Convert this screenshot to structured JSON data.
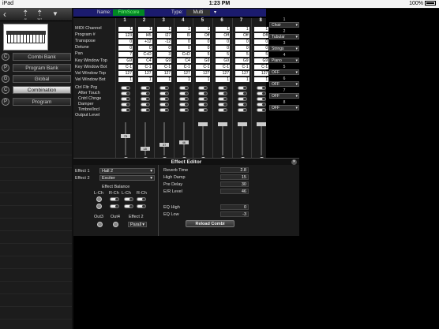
{
  "status": {
    "device": "iPad",
    "wifi": "wifi-icon",
    "time": "1:23 PM",
    "battery": "100%"
  },
  "toolbar": {
    "b1": "All",
    "b2": "SET"
  },
  "thumbnail": {
    "caption": ""
  },
  "nav": [
    {
      "label": "Combi Bank",
      "icon": "C"
    },
    {
      "label": "Program Bank",
      "icon": "P"
    },
    {
      "label": "Global",
      "icon": "G"
    },
    {
      "label": "Combination",
      "icon": "C",
      "active": true
    },
    {
      "label": "Program",
      "icon": "P"
    }
  ],
  "header": {
    "name_label": "Name:",
    "name_value": "FilmScore",
    "type_label": "Type:",
    "type_value": "Multi"
  },
  "tracks": [
    "1",
    "2",
    "3",
    "4",
    "5",
    "6",
    "7",
    "8"
  ],
  "rows": [
    {
      "label": "MIDI Channel",
      "values": [
        "1",
        "1",
        "1",
        "1",
        "1",
        "1",
        "1",
        "1"
      ]
    },
    {
      "label": "Program #",
      "values": [
        "123",
        "I45",
        "I27",
        "I9",
        "Off",
        "Off",
        "Off",
        "Off"
      ]
    },
    {
      "label": "Transpose",
      "values": [
        "0",
        "+12",
        "-12",
        "0",
        "0",
        "0",
        "0",
        "0"
      ]
    },
    {
      "label": "Detune",
      "values": [
        "0",
        "0",
        "0",
        "0",
        "0",
        "0",
        "0",
        "0"
      ]
    },
    {
      "label": "Pan",
      "values": [
        "7",
        "C+D",
        "3",
        "C+D",
        "5",
        "5",
        "5",
        "5"
      ]
    },
    {
      "label": "Key Window Top",
      "values": [
        "G9",
        "C4",
        "G9",
        "C4",
        "G9",
        "G9",
        "G9",
        "G9"
      ]
    },
    {
      "label": "Key Window Bot",
      "values": [
        "C-1",
        "C-1",
        "C-1",
        "C-1",
        "C-1",
        "C-1",
        "C-1",
        "C-1"
      ]
    },
    {
      "label": "Vel Window Top",
      "values": [
        "127",
        "127",
        "127",
        "127",
        "127",
        "127",
        "127",
        "127"
      ]
    },
    {
      "label": "Vel Window Bot",
      "values": [
        "1",
        "1",
        "1",
        "1",
        "1",
        "1",
        "1",
        "1"
      ]
    }
  ],
  "switch_rows": [
    "Ctrl Fltr Prg",
    "After Touch",
    "Cntrl Chnge",
    "Damper",
    "Timbre/Incl"
  ],
  "output_level_label": "Output Level",
  "fader_values": [
    "75",
    "18",
    "37",
    "46",
    "",
    "",
    "",
    ""
  ],
  "right_panel": [
    {
      "num": "1",
      "value": "Choir"
    },
    {
      "num": "2",
      "value": "Tubular"
    },
    {
      "num": "3",
      "value": "Strings"
    },
    {
      "num": "4",
      "value": "Piano"
    },
    {
      "num": "5",
      "value": "OFF"
    },
    {
      "num": "6",
      "value": "OFF"
    },
    {
      "num": "7",
      "value": "OFF"
    },
    {
      "num": "8",
      "value": "OFF"
    }
  ],
  "effect_editor": {
    "title": "Effect Editor",
    "effect1_label": "Effect 1",
    "effect1_value": "Hall 2",
    "effect2_label": "Effect 2",
    "effect2_value": "Exciter",
    "balance_title": "Effect Balance",
    "lch": "L-Ch",
    "rch": "R-Ch",
    "out3": "Out3",
    "out4": "Out4",
    "effect2_mode_label": "Effect 2",
    "effect2_mode": "Parall",
    "params": [
      {
        "label": "Reverb Time",
        "value": "2.8"
      },
      {
        "label": "High Damp",
        "value": "15"
      },
      {
        "label": "Pre Delay",
        "value": "30"
      },
      {
        "label": "E/R Level",
        "value": "46"
      }
    ],
    "eq": [
      {
        "label": "EQ High",
        "value": "0"
      },
      {
        "label": "EQ Low",
        "value": "-3"
      }
    ],
    "reload_label": "Reload Combi"
  }
}
